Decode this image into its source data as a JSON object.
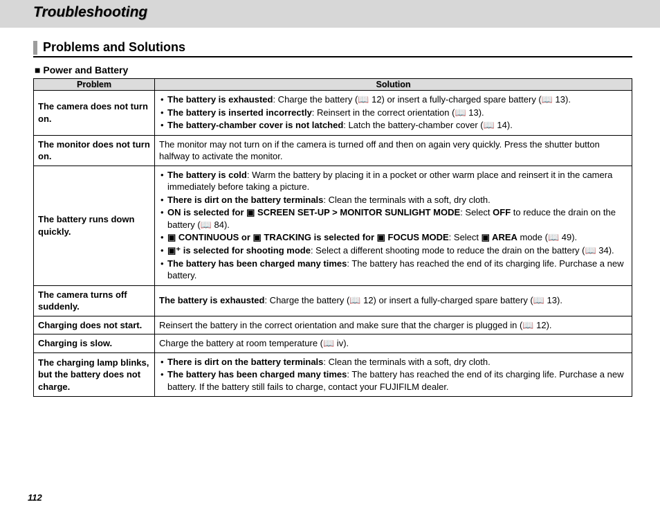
{
  "header": {
    "title": "Troubleshooting"
  },
  "section": {
    "title": "Problems and Solutions"
  },
  "subsection": {
    "title": "Power and Battery"
  },
  "table": {
    "headers": {
      "problem": "Problem",
      "solution": "Solution"
    },
    "rows": [
      {
        "problem": "The camera does not turn on.",
        "bullets": [
          {
            "strong": "The battery is exhausted",
            "rest": ": Charge the battery (📖 12) or insert a fully-charged spare battery (📖 13)."
          },
          {
            "strong": "The battery is inserted incorrectly",
            "rest": ": Reinsert in the correct orientation (📖 13)."
          },
          {
            "strong": "The battery-chamber cover is not latched",
            "rest": ": Latch the battery-chamber cover (📖 14)."
          }
        ]
      },
      {
        "problem": "The monitor does not turn on.",
        "plain": "The monitor may not turn on if the camera is turned off and then on again very quickly. Press the shutter button halfway to activate the monitor."
      },
      {
        "problem": "The battery runs down quickly.",
        "bullets": [
          {
            "strong": "The battery is cold",
            "rest": ": Warm the battery by placing it in a pocket or other warm place and reinsert it in the camera immediately before taking a picture."
          },
          {
            "strong": "There is dirt on the battery terminals",
            "rest": ": Clean the terminals with a soft, dry cloth."
          },
          {
            "html": true,
            "strong": "ON is selected for ▣ SCREEN SET-UP > MONITOR SUNLIGHT MODE",
            "rest_pre": ": Select ",
            "rest_bold": "OFF",
            "rest_post": " to reduce the drain on the battery (📖 84)."
          },
          {
            "html": true,
            "strong": "▣ CONTINUOUS or ▣ TRACKING is selected for ▣ FOCUS MODE",
            "rest_pre": ": Select ",
            "rest_bold": "▣ AREA",
            "rest_post": " mode (📖 49)."
          },
          {
            "strong": "▣⁺ is selected for shooting mode",
            "rest": ": Select a different shooting mode to reduce the drain on the battery (📖 34)."
          },
          {
            "strong": "The battery has been charged many times",
            "rest": ": The battery has reached the end of its charging life. Purchase a new battery."
          }
        ]
      },
      {
        "problem": "The camera turns off suddenly.",
        "lead_strong": "The battery is exhausted",
        "lead_rest": ": Charge the battery (📖 12) or insert a fully-charged spare battery (📖 13)."
      },
      {
        "problem": "Charging does not start.",
        "plain": "Reinsert the battery in the correct orientation and make sure that the charger is plugged in (📖 12)."
      },
      {
        "problem": "Charging is slow.",
        "plain": "Charge the battery at room temperature (📖 iv)."
      },
      {
        "problem": "The charging lamp blinks, but the battery does not charge.",
        "bullets": [
          {
            "strong": "There is dirt on the battery terminals",
            "rest": ": Clean the terminals with a soft, dry cloth."
          },
          {
            "strong": "The battery has been charged many times",
            "rest": ": The battery has reached the end of its charging life.  Purchase a new battery.  If the battery still fails to charge, contact your FUJIFILM dealer."
          }
        ]
      }
    ]
  },
  "page_number": "112"
}
